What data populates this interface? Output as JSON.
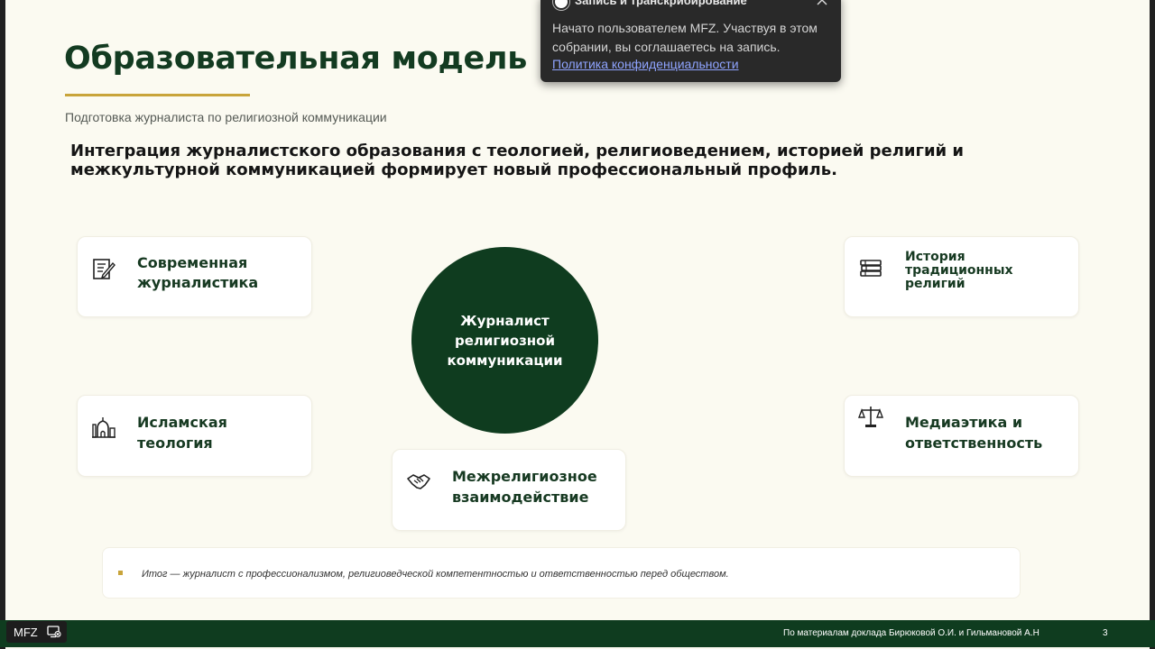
{
  "slide": {
    "title": "Образовательная модель Р",
    "subtitle": "Подготовка журналиста по религиозной коммуникации",
    "lead": "Интеграция журналистского образования с теологией, религиоведением, историей религий и межкультурной коммуникацией формирует новый профессиональный профиль.",
    "center_label": "Журналист религиозной коммуникации",
    "cards": {
      "journalism": {
        "label": "Современная журналистика",
        "icon": "document-pen-icon"
      },
      "history": {
        "label": "История традиционных религий",
        "icon": "books-icon"
      },
      "islam": {
        "label": "Исламская теология",
        "icon": "mosque-icon"
      },
      "ethics": {
        "label": "Медиаэтика и ответственность",
        "icon": "scales-icon"
      },
      "interfaith": {
        "label": "Межрелигиозное взаимодействие",
        "icon": "handshake-icon"
      }
    },
    "summary": "Итог — журналист с профессионализмом, религиоведческой компетентностью и ответственностью перед обществом.",
    "footer_credit": "По материалам доклада Бирюковой О.И. и Гильмановой А.Н",
    "page_number": "3"
  },
  "host_badge": {
    "name": "MFZ",
    "icon": "screen-share-icon"
  },
  "notification": {
    "title": "Запись и транскрибирование",
    "body": "Начато пользователем MFZ. Участвуя в этом собрании, вы соглашаетесь на запись.",
    "link": "Политика конфиденциальности",
    "close_icon": "close-icon"
  },
  "colors": {
    "brand_green": "#0f3c1f",
    "accent_gold": "#c8a43a",
    "background": "#fbfaf1"
  }
}
